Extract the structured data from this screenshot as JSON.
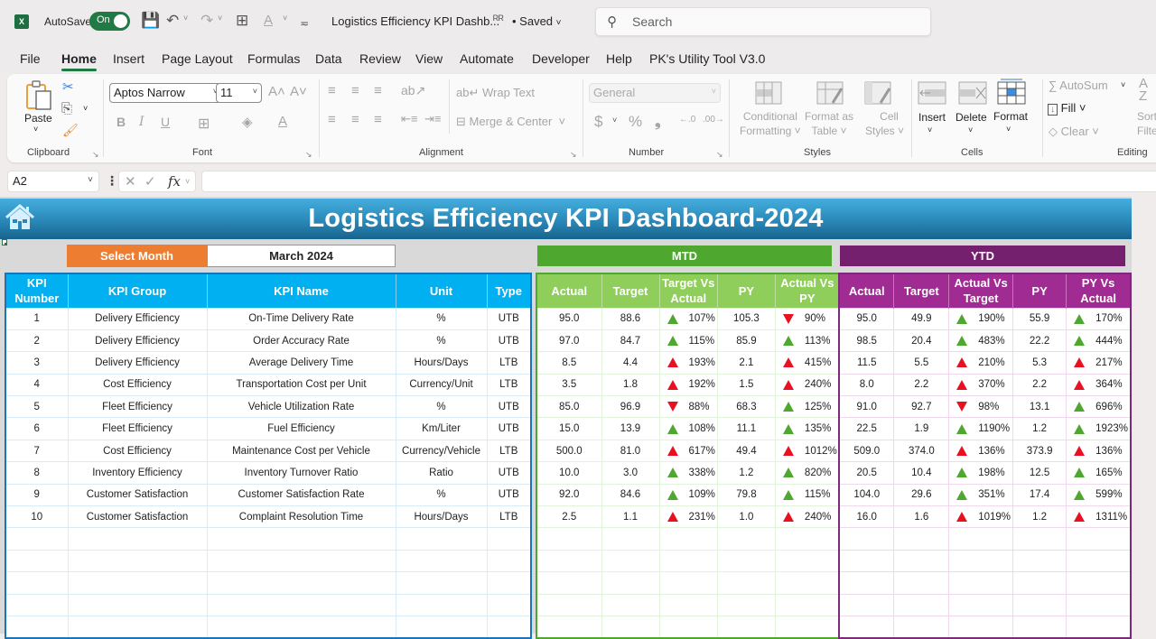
{
  "titlebar": {
    "app_icon": "excel-logo-icon",
    "app_letter": "X",
    "autosave_label": "AutoSave",
    "autosave_state": "On",
    "doc_title": "Logistics Efficiency KPI Dashb...",
    "save_status": "• Saved",
    "search_placeholder": "Search"
  },
  "menu": {
    "tabs": [
      "File",
      "Home",
      "Insert",
      "Page Layout",
      "Formulas",
      "Data",
      "Review",
      "View",
      "Automate",
      "Developer",
      "Help",
      "PK's Utility Tool V3.0"
    ],
    "active": "Home"
  },
  "ribbon": {
    "clipboard": {
      "paste": "Paste",
      "label": "Clipboard"
    },
    "font": {
      "font_name": "Aptos Narrow",
      "font_size": "11",
      "bold": "B",
      "italic": "I",
      "underline": "U",
      "label": "Font"
    },
    "alignment": {
      "wrap_text": "Wrap Text",
      "merge_center": "Merge & Center",
      "label": "Alignment"
    },
    "number": {
      "format": "General",
      "currency": "$",
      "percent": "%",
      "comma": "❟",
      "label": "Number"
    },
    "styles": {
      "conditional": [
        "Conditional",
        "Formatting ˅"
      ],
      "format_table": [
        "Format as",
        "Table ˅"
      ],
      "cell_styles": [
        "Cell",
        "Styles ˅"
      ],
      "label": "Styles"
    },
    "cells": {
      "insert": "Insert",
      "delete": "Delete",
      "format": "Format",
      "label": "Cells"
    },
    "editing": {
      "autosum": "AutoSum",
      "fill": "Fill",
      "clear": "Clear",
      "sort": [
        "Sort",
        "Filte"
      ],
      "label": "Editing"
    }
  },
  "formula_bar": {
    "name_box": "A2",
    "fx": "fx",
    "formula": ""
  },
  "dashboard": {
    "title": "Logistics Efficiency KPI Dashboard-2024",
    "select_month_label": "Select Month",
    "selected_month": "March 2024",
    "mtd_title": "MTD",
    "ytd_title": "YTD",
    "colors": {
      "banner": "#2a88b8",
      "month_label": "#ed7d31",
      "mtd": "#4ea72e",
      "ytd": "#74206e",
      "info_header": "#00b0f0",
      "up_good": "#4ea72e",
      "alert_red": "#e81123"
    },
    "info_headers": [
      "KPI Number",
      "KPI Group",
      "KPI Name",
      "Unit",
      "Type"
    ],
    "mtd_headers": [
      "Actual",
      "Target",
      "Target Vs Actual",
      "PY",
      "Actual Vs PY"
    ],
    "ytd_headers": [
      "Actual",
      "Target",
      "Actual Vs Target",
      "PY",
      "PY Vs Actual"
    ],
    "rows": [
      {
        "num": "1",
        "group": "Delivery Efficiency",
        "name": "On-Time Delivery Rate",
        "unit": "%",
        "type": "UTB",
        "mtd": {
          "actual": "95.0",
          "target": "88.6",
          "tva": "107%",
          "tva_icon": "up-green",
          "py": "105.3",
          "avp": "90%",
          "avp_icon": "down-red"
        },
        "ytd": {
          "actual": "95.0",
          "target": "49.9",
          "avt": "190%",
          "avt_icon": "up-green",
          "py": "55.9",
          "pva": "170%",
          "pva_icon": "up-green"
        }
      },
      {
        "num": "2",
        "group": "Delivery Efficiency",
        "name": "Order Accuracy Rate",
        "unit": "%",
        "type": "UTB",
        "mtd": {
          "actual": "97.0",
          "target": "84.7",
          "tva": "115%",
          "tva_icon": "up-green",
          "py": "85.9",
          "avp": "113%",
          "avp_icon": "up-green"
        },
        "ytd": {
          "actual": "98.5",
          "target": "20.4",
          "avt": "483%",
          "avt_icon": "up-green",
          "py": "22.2",
          "pva": "444%",
          "pva_icon": "up-green"
        }
      },
      {
        "num": "3",
        "group": "Delivery Efficiency",
        "name": "Average Delivery Time",
        "unit": "Hours/Days",
        "type": "LTB",
        "mtd": {
          "actual": "8.5",
          "target": "4.4",
          "tva": "193%",
          "tva_icon": "up-red",
          "py": "2.1",
          "avp": "415%",
          "avp_icon": "up-red"
        },
        "ytd": {
          "actual": "11.5",
          "target": "5.5",
          "avt": "210%",
          "avt_icon": "up-red",
          "py": "5.3",
          "pva": "217%",
          "pva_icon": "up-red"
        }
      },
      {
        "num": "4",
        "group": "Cost Efficiency",
        "name": "Transportation Cost per Unit",
        "unit": "Currency/Unit",
        "type": "LTB",
        "mtd": {
          "actual": "3.5",
          "target": "1.8",
          "tva": "192%",
          "tva_icon": "up-red",
          "py": "1.5",
          "avp": "240%",
          "avp_icon": "up-red"
        },
        "ytd": {
          "actual": "8.0",
          "target": "2.2",
          "avt": "370%",
          "avt_icon": "up-red",
          "py": "2.2",
          "pva": "364%",
          "pva_icon": "up-red"
        }
      },
      {
        "num": "5",
        "group": "Fleet Efficiency",
        "name": "Vehicle Utilization Rate",
        "unit": "%",
        "type": "UTB",
        "mtd": {
          "actual": "85.0",
          "target": "96.9",
          "tva": "88%",
          "tva_icon": "down-red",
          "py": "68.3",
          "avp": "125%",
          "avp_icon": "up-green"
        },
        "ytd": {
          "actual": "91.0",
          "target": "92.7",
          "avt": "98%",
          "avt_icon": "down-red",
          "py": "13.1",
          "pva": "696%",
          "pva_icon": "up-green"
        }
      },
      {
        "num": "6",
        "group": "Fleet Efficiency",
        "name": "Fuel Efficiency",
        "unit": "Km/Liter",
        "type": "UTB",
        "mtd": {
          "actual": "15.0",
          "target": "13.9",
          "tva": "108%",
          "tva_icon": "up-green",
          "py": "11.1",
          "avp": "135%",
          "avp_icon": "up-green"
        },
        "ytd": {
          "actual": "22.5",
          "target": "1.9",
          "avt": "1190%",
          "avt_icon": "up-green",
          "py": "1.2",
          "pva": "1923%",
          "pva_icon": "up-green"
        }
      },
      {
        "num": "7",
        "group": "Cost Efficiency",
        "name": "Maintenance Cost per Vehicle",
        "unit": "Currency/Vehicle",
        "type": "LTB",
        "mtd": {
          "actual": "500.0",
          "target": "81.0",
          "tva": "617%",
          "tva_icon": "up-red",
          "py": "49.4",
          "avp": "1012%",
          "avp_icon": "up-red"
        },
        "ytd": {
          "actual": "509.0",
          "target": "374.0",
          "avt": "136%",
          "avt_icon": "up-red",
          "py": "373.9",
          "pva": "136%",
          "pva_icon": "up-red"
        }
      },
      {
        "num": "8",
        "group": "Inventory Efficiency",
        "name": "Inventory Turnover Ratio",
        "unit": "Ratio",
        "type": "UTB",
        "mtd": {
          "actual": "10.0",
          "target": "3.0",
          "tva": "338%",
          "tva_icon": "up-green",
          "py": "1.2",
          "avp": "820%",
          "avp_icon": "up-green"
        },
        "ytd": {
          "actual": "20.5",
          "target": "10.4",
          "avt": "198%",
          "avt_icon": "up-green",
          "py": "12.5",
          "pva": "165%",
          "pva_icon": "up-green"
        }
      },
      {
        "num": "9",
        "group": "Customer Satisfaction",
        "name": "Customer Satisfaction Rate",
        "unit": "%",
        "type": "UTB",
        "mtd": {
          "actual": "92.0",
          "target": "84.6",
          "tva": "109%",
          "tva_icon": "up-green",
          "py": "79.8",
          "avp": "115%",
          "avp_icon": "up-green"
        },
        "ytd": {
          "actual": "104.0",
          "target": "29.6",
          "avt": "351%",
          "avt_icon": "up-green",
          "py": "17.4",
          "pva": "599%",
          "pva_icon": "up-green"
        }
      },
      {
        "num": "10",
        "group": "Customer Satisfaction",
        "name": "Complaint Resolution Time",
        "unit": "Hours/Days",
        "type": "LTB",
        "mtd": {
          "actual": "2.5",
          "target": "1.1",
          "tva": "231%",
          "tva_icon": "up-red",
          "py": "1.0",
          "avp": "240%",
          "avp_icon": "up-red"
        },
        "ytd": {
          "actual": "16.0",
          "target": "1.6",
          "avt": "1019%",
          "avt_icon": "up-red",
          "py": "1.2",
          "pva": "1311%",
          "pva_icon": "up-red"
        }
      }
    ]
  }
}
